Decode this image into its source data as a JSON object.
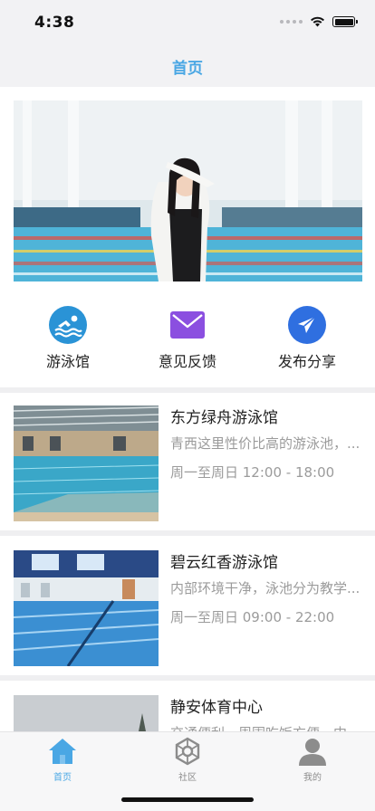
{
  "status": {
    "time": "4:38"
  },
  "nav": {
    "title": "首页"
  },
  "quick_actions": [
    {
      "label": "游泳馆",
      "icon": "swimmer-icon",
      "color": "#2a93d6"
    },
    {
      "label": "意见反馈",
      "icon": "envelope-icon",
      "color": "#8b4fe0"
    },
    {
      "label": "发布分享",
      "icon": "paper-plane-icon",
      "color": "#2f6fe0"
    }
  ],
  "venues": [
    {
      "name": "东方绿舟游泳馆",
      "desc": "青西这里性价比高的游泳池，...",
      "hours": "周一至周日 12:00 - 18:00"
    },
    {
      "name": "碧云红香游泳馆",
      "desc": "内部环境干净，泳池分为教学...",
      "hours": "周一至周日 09:00 - 22:00"
    },
    {
      "name": "静安体育中心",
      "desc": "交通便利，周围吃饭方便，中..."
    }
  ],
  "tabs": [
    {
      "label": "首页",
      "icon": "home-icon",
      "active": true
    },
    {
      "label": "社区",
      "icon": "community-icon",
      "active": false
    },
    {
      "label": "我的",
      "icon": "profile-icon",
      "active": false
    }
  ],
  "colors": {
    "accent": "#4aa7e4",
    "inactive": "#8c8c8c"
  }
}
